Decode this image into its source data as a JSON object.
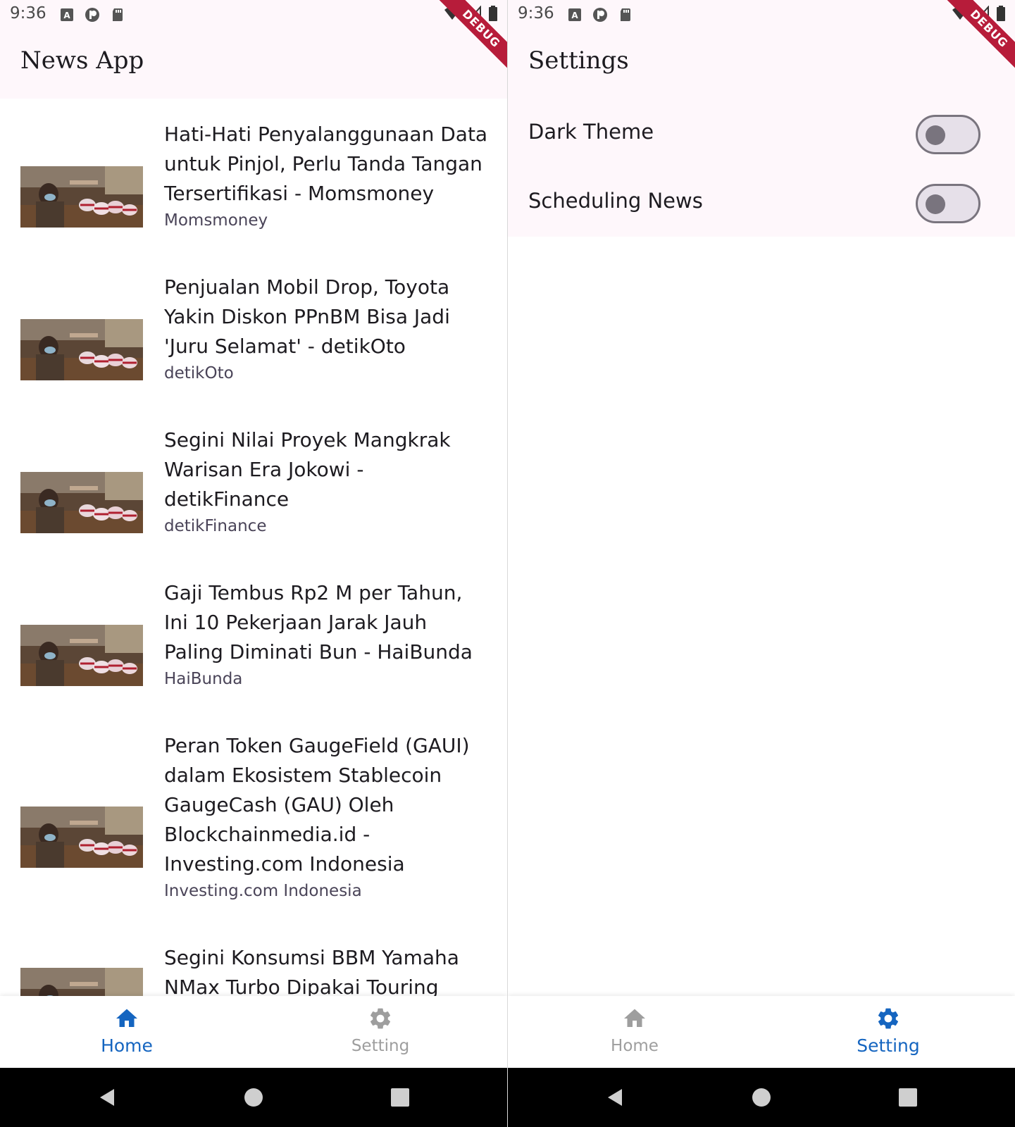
{
  "left_screen": {
    "status_bar": {
      "time": "9:36"
    },
    "debug_label": "DEBUG",
    "app_title": "News App",
    "articles": [
      {
        "title": "Hati-Hati Penyalanggunaan Data untuk Pinjol, Perlu Tanda Tangan Tersertifikasi - Momsmoney",
        "source": "Momsmoney"
      },
      {
        "title": "Penjualan Mobil Drop, Toyota Yakin Diskon PPnBM Bisa Jadi 'Juru Selamat' - detikOto",
        "source": "detikOto"
      },
      {
        "title": "Segini Nilai Proyek Mangkrak Warisan Era Jokowi - detikFinance",
        "source": "detikFinance"
      },
      {
        "title": "Gaji Tembus Rp2 M per Tahun, Ini 10 Pekerjaan Jarak Jauh Paling Diminati Bun - HaiBunda",
        "source": "HaiBunda"
      },
      {
        "title": "Peran Token GaugeField (GAUI) dalam Ekosistem Stablecoin GaugeCash (GAU) Oleh Blockchainmedia.id - Investing.com Indonesia",
        "source": "Investing.com Indonesia"
      },
      {
        "title": "Segini Konsumsi BBM Yamaha NMax Turbo Dipakai Touring",
        "source": ""
      }
    ],
    "bottom_nav": {
      "items": [
        {
          "label": "Home",
          "icon": "home-icon",
          "active": true
        },
        {
          "label": "Setting",
          "icon": "gear-icon",
          "active": false
        }
      ]
    }
  },
  "right_screen": {
    "status_bar": {
      "time": "9:36"
    },
    "debug_label": "DEBUG",
    "app_title": "Settings",
    "settings": [
      {
        "label": "Dark Theme",
        "enabled": false
      },
      {
        "label": "Scheduling News",
        "enabled": false
      }
    ],
    "bottom_nav": {
      "items": [
        {
          "label": "Home",
          "icon": "home-icon",
          "active": false
        },
        {
          "label": "Setting",
          "icon": "gear-icon",
          "active": true
        }
      ]
    }
  },
  "colors": {
    "accent": "#1565c0",
    "inactive": "#9e9e9e",
    "app_bar_bg": "#fef7fb",
    "debug_ribbon": "#b71c3a"
  }
}
